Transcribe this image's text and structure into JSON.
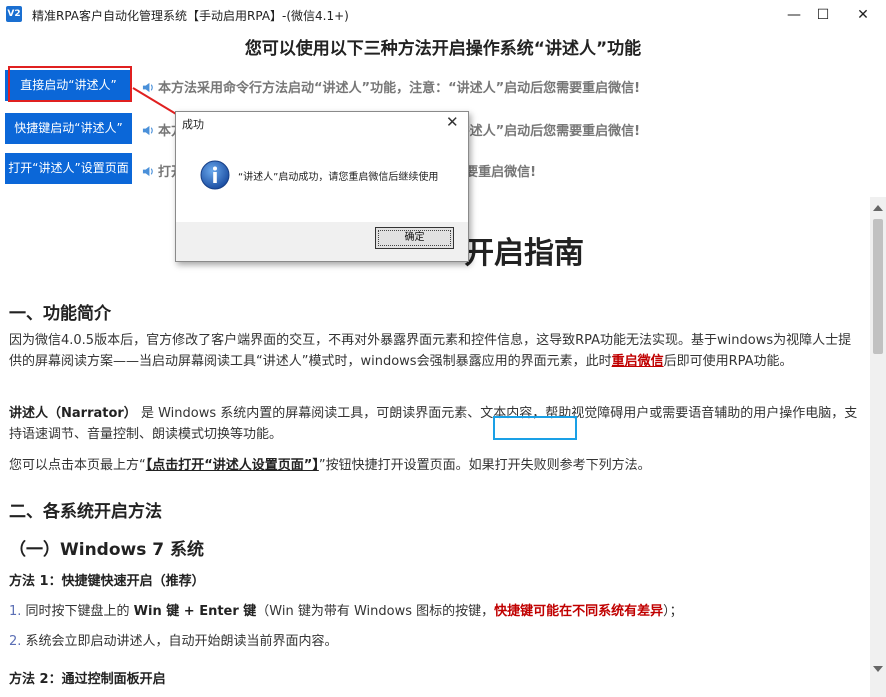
{
  "window": {
    "title": "精准RPA客户自动化管理系统【手动启用RPA】-(微信4.1+)",
    "app_icon_text": "V2",
    "minimize": "—",
    "maximize": "☐",
    "close": "✕"
  },
  "header": {
    "headline": "您可以使用以下三种方法开启操作系统“讲述人”功能"
  },
  "methods": [
    {
      "button": "直接启动“讲述人”",
      "note": "本方法采用命令行方法启动“讲述人”功能，注意：“讲述人”启动后您需要重启微信!"
    },
    {
      "button": "快捷键启动“讲述人”",
      "note": "本方法采用快捷键方法启动“讲述人”功能，注意：“讲述人”启动后您需要重启微信!"
    },
    {
      "button": "打开“讲述人”设置页面",
      "note": "打开“讲述人”设置页面，注意：“讲述人”启动后您需要重启微信!"
    }
  ],
  "guide": {
    "title_visible": "开启指南",
    "section1": "一、功能简介",
    "p1_a": "因为微信4.0.5版本后，官方修改了客户端界面的交互，不再对外暴露界面元素和控件信息，这导致RPA功能无法实现。基于windows为视障人士提供的屏幕阅读方案——当启动屏幕阅读工具“讲述人”模式时，windows会强制暴露应用的界面元素，此时",
    "p1_link": "重启微信",
    "p1_b": "后即可使用RPA功能。",
    "p2_bold": "讲述人（Narrator）",
    "p2_rest": " 是 Windows 系统内置的屏幕阅读工具，可朗读界面元素、文本内容，帮助视觉障碍用户或需要语音辅助的用户操作电脑，支持语速调节、音量控制、朗读模式切换等功能。",
    "p3_a": "您可以点击本页最上方“",
    "p3_link": "【点击打开“讲述人设置页面”】",
    "p3_b": "”按钮快捷打开设置页面。如果打开失败则参考下列方法。",
    "section2": "二、各系统开启方法",
    "sub1": "（一）Windows 7 系统",
    "method1": "方法 1：快捷键快速开启（推荐）",
    "step1_num": "1.",
    "step1_a": " 同时按下键盘上的 ",
    "step1_keys": "Win 键 + Enter 键",
    "step1_b": "（Win 键为带有 Windows 图标的按键，",
    "step1_red": "快捷键可能在不同系统有差异",
    "step1_c": "）；",
    "step2_num": "2.",
    "step2": " 系统会立即启动讲述人，自动开始朗读当前界面内容。",
    "method2": "方法 2：通过控制面板开启"
  },
  "dialog": {
    "title": "成功",
    "message": "“讲述人”启动成功，请您重启微信后继续使用",
    "ok": "确定",
    "close": "✕"
  },
  "colors": {
    "button_blue": "#0b67d8",
    "highlight_red": "#e02020",
    "link_red": "#c00000",
    "focus_cyan": "#1aa0e6"
  }
}
